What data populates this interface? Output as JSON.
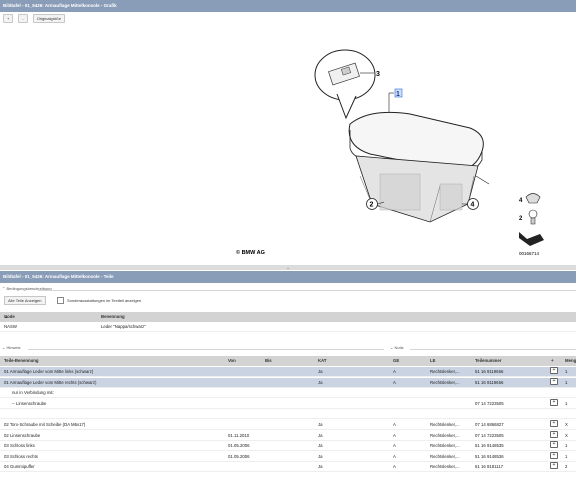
{
  "top_panel": {
    "title": "Bildtafel - 01_5426: Armauflage Mittelkonsole - Grafik",
    "zoom_in_label": "+",
    "zoom_out_label": "-",
    "original_size_label": "Originalgröße"
  },
  "drawing": {
    "callouts": [
      "3",
      "1",
      "2",
      "4",
      "4",
      "2"
    ],
    "copyright": "© BMW AG",
    "image_number": "00166714"
  },
  "bottom_panel": {
    "title": "Bildtafel - 01_5426: Armauflage Mittelkonsole - Teile",
    "conditions_header": "Bedingungsbeschreibung",
    "show_all_parts_button": "Alle Teile Anzeigen",
    "show_special_equipment_label": "Sonderausstattungen im Textteil anzeigen",
    "code_table": {
      "headers": [
        "Code",
        "Benennung"
      ],
      "rows": [
        [
          "NASW",
          "Leder \"Nappa/schwarz\""
        ]
      ]
    },
    "hints_header": "Hinweis",
    "note_header": "Notiz",
    "parts_table": {
      "headers": [
        "Teile-Benennung",
        "Von",
        "Bis",
        "KAT",
        "GE",
        "LE",
        "Teilenummer",
        "+",
        "Meng"
      ],
      "rows": [
        {
          "name": "01 Armauflage Leder vom Mitte links (schwarz)",
          "von": "",
          "bis": "",
          "kat": "Ja",
          "ge": "A",
          "le": "Rechtslenker,...",
          "nr": "51 16 9119656",
          "qty": "1",
          "selected": true
        },
        {
          "name": "01 Armauflage Leder vom Mitte rechts (schwarz)",
          "von": "",
          "bis": "",
          "kat": "Ja",
          "ge": "A",
          "le": "Rechtslenker,...",
          "nr": "51 16 9119656",
          "qty": "1",
          "selected": true
        },
        {
          "name": "nur in Verbindung mit:",
          "von": "",
          "bis": "",
          "kat": "",
          "ge": "",
          "le": "",
          "nr": "",
          "qty": "",
          "indent": true,
          "noplus": true
        },
        {
          "name": "-- Linsenschraube",
          "von": "",
          "bis": "",
          "kat": "",
          "ge": "",
          "le": "",
          "nr": "07 14 7223505",
          "qty": "1",
          "indent": true
        },
        {
          "name": "",
          "von": "",
          "bis": "",
          "kat": "",
          "ge": "",
          "le": "",
          "nr": "",
          "qty": "",
          "noplus": true
        },
        {
          "name": "02 Torx-Schraube mit Scheibe (DA M6x17)",
          "von": "",
          "bis": "",
          "kat": "Ja",
          "ge": "A",
          "le": "Rechtslenker,...",
          "nr": "07 14 6866827",
          "qty": "X"
        },
        {
          "name": "02 Linsenschraube",
          "von": "01.11.2010",
          "bis": "",
          "kat": "Ja",
          "ge": "A",
          "le": "Rechtslenker,...",
          "nr": "07 14 7223505",
          "qty": "X"
        },
        {
          "name": "03 Schloss links",
          "von": "01.05.2006",
          "bis": "",
          "kat": "Ja",
          "ge": "A",
          "le": "Rechtslenker,...",
          "nr": "51 16 9148535",
          "qty": "1"
        },
        {
          "name": "03 Schloss rechts",
          "von": "01.05.2006",
          "bis": "",
          "kat": "Ja",
          "ge": "A",
          "le": "Rechtslenker,...",
          "nr": "51 16 9148536",
          "qty": "1"
        },
        {
          "name": "04 Gummipuffer",
          "von": "",
          "bis": "",
          "kat": "Ja",
          "ge": "A",
          "le": "Rechtslenker,...",
          "nr": "51 16 9181117",
          "qty": "2"
        }
      ]
    }
  },
  "colors": {
    "title_bar": "#8a9db8",
    "selected_row": "#c9d3e2",
    "header_row": "#d3d3d3"
  }
}
